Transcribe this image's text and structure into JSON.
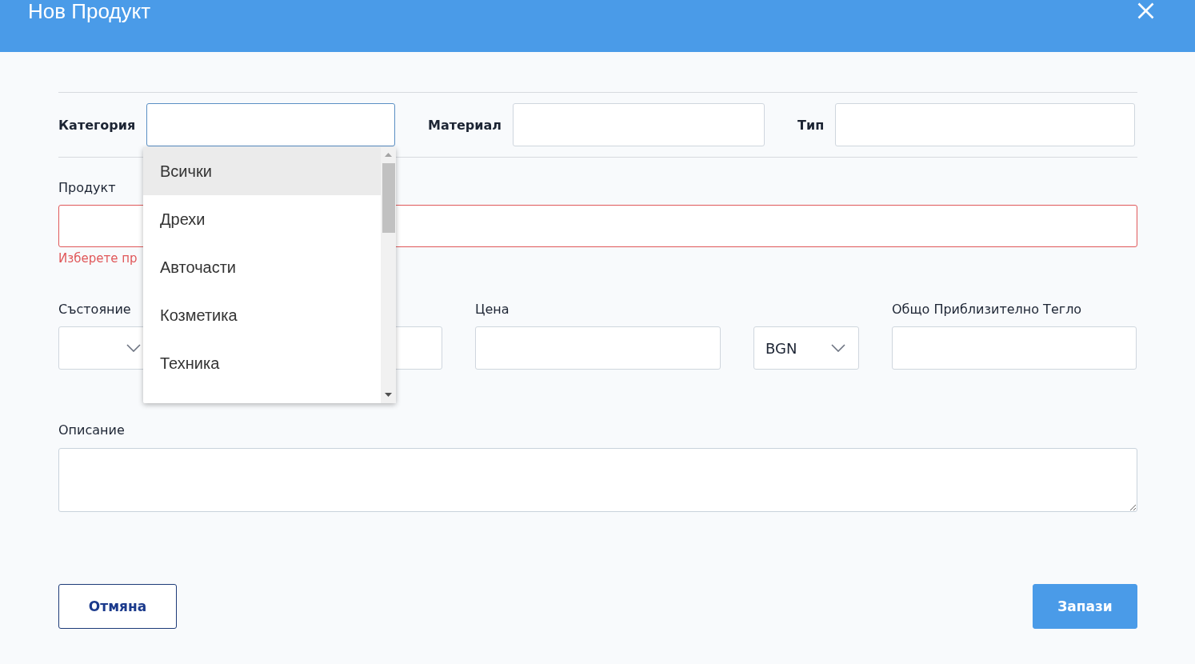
{
  "header": {
    "title": "Нов Продукт"
  },
  "top_row": [
    {
      "label": "Категория",
      "focused": true
    },
    {
      "label": "Материал",
      "focused": false
    },
    {
      "label": "Тип",
      "focused": false
    }
  ],
  "product": {
    "label": "Продукт",
    "invalid": true,
    "error": "Изберете пр"
  },
  "middle_row": [
    {
      "label": "Състояние",
      "kind": "select"
    },
    {
      "kind": "input"
    },
    {
      "label": "Цена",
      "kind": "input"
    },
    {
      "kind": "select",
      "value": "BGN"
    },
    {
      "label": "Общо Приблизително Тегло",
      "kind": "input"
    }
  ],
  "description": {
    "label": "Описание"
  },
  "category_dropdown": {
    "options": [
      {
        "label": "Всички",
        "selected": true
      },
      {
        "label": "Дрехи",
        "selected": false
      },
      {
        "label": "Авточасти",
        "selected": false
      },
      {
        "label": "Козметика",
        "selected": false
      },
      {
        "label": "Техника",
        "selected": false
      }
    ]
  },
  "buttons": [
    {
      "label": "Отмяна",
      "kind": "secondary"
    },
    {
      "label": "Запази",
      "kind": "primary"
    }
  ]
}
